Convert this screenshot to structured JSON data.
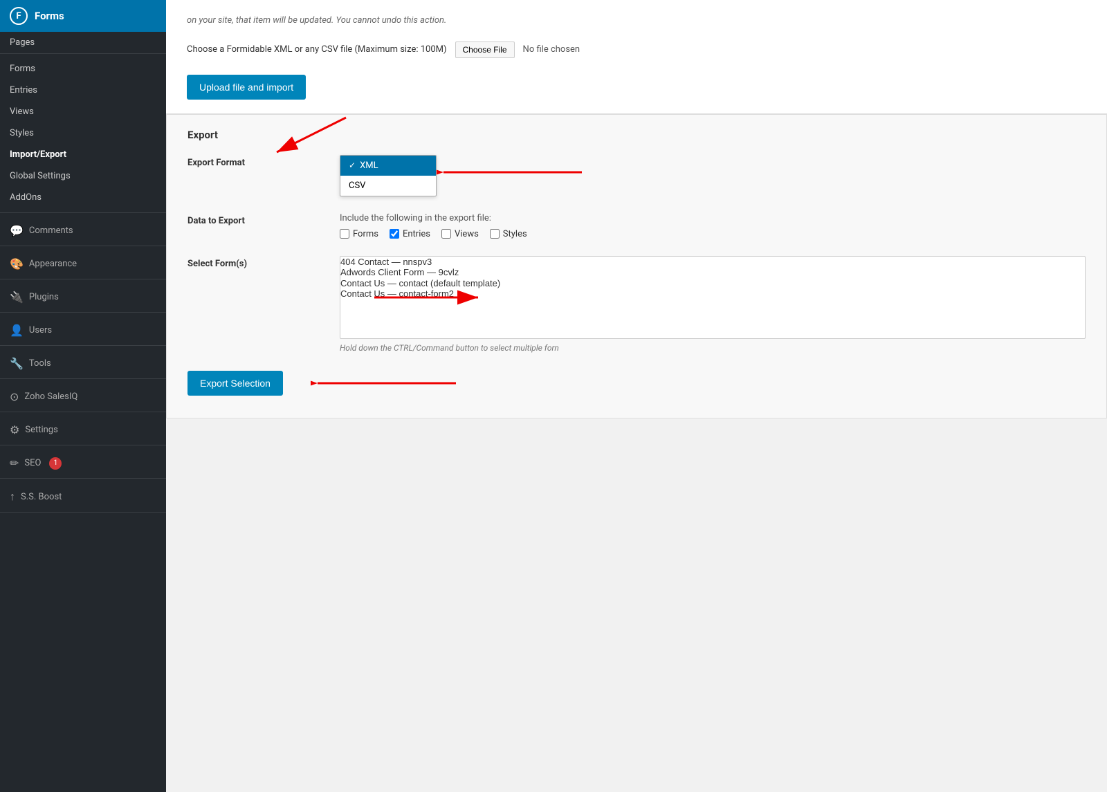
{
  "sidebar": {
    "plugin_name": "Forms",
    "plugin_icon": "F",
    "items_top": [
      {
        "label": "Pages",
        "id": "pages"
      }
    ],
    "items_forms": [
      {
        "label": "Forms",
        "id": "forms"
      },
      {
        "label": "Entries",
        "id": "entries"
      },
      {
        "label": "Views",
        "id": "views"
      },
      {
        "label": "Styles",
        "id": "styles"
      },
      {
        "label": "Import/Export",
        "id": "import-export",
        "active": true
      },
      {
        "label": "Global Settings",
        "id": "global-settings"
      },
      {
        "label": "AddOns",
        "id": "addons"
      }
    ],
    "items_main": [
      {
        "label": "Comments",
        "id": "comments",
        "icon": "💬",
        "is_header": true
      },
      {
        "label": "Appearance",
        "id": "appearance",
        "icon": "🎨",
        "is_header": true
      },
      {
        "label": "Plugins",
        "id": "plugins",
        "icon": "🔌",
        "is_header": true
      },
      {
        "label": "Users",
        "id": "users",
        "icon": "👤",
        "is_header": true
      },
      {
        "label": "Tools",
        "id": "tools",
        "icon": "🔧",
        "is_header": true
      },
      {
        "label": "Zoho SalesIQ",
        "id": "zoho",
        "icon": "⊙",
        "is_header": true
      },
      {
        "label": "Settings",
        "id": "settings",
        "icon": "⚙",
        "is_header": true
      },
      {
        "label": "SEO",
        "id": "seo",
        "icon": "✏",
        "is_header": true,
        "badge": "1"
      },
      {
        "label": "S.S. Boost",
        "id": "ssboost",
        "icon": "↑",
        "is_header": true
      }
    ]
  },
  "main": {
    "warning_text": "on your site, that item will be updated. You cannot undo this action.",
    "file_description": "Choose a Formidable XML or any CSV file (Maximum size: 100M)",
    "choose_file_label": "Choose File",
    "no_file_label": "No file chosen",
    "upload_btn_label": "Upload file and import",
    "export": {
      "section_title": "Export",
      "export_format_label": "Export Format",
      "dropdown_options": [
        {
          "label": "XML",
          "selected": true
        },
        {
          "label": "CSV",
          "selected": false
        }
      ],
      "data_to_export_label": "Data to Export",
      "include_label": "Include the following in the export file:",
      "checkboxes": [
        {
          "label": "Forms",
          "checked": false
        },
        {
          "label": "Entries",
          "checked": true
        },
        {
          "label": "Views",
          "checked": false
        },
        {
          "label": "Styles",
          "checked": false
        }
      ],
      "select_forms_label": "Select Form(s)",
      "forms_list": [
        "404 Contact — nnspv3",
        "Adwords Client Form — 9cvlz",
        "Contact Us — contact (default template)",
        "Contact Us — contact-form2"
      ],
      "select_hint": "Hold down the CTRL/Command button to select multiple forn",
      "export_btn_label": "Export Selection"
    }
  }
}
